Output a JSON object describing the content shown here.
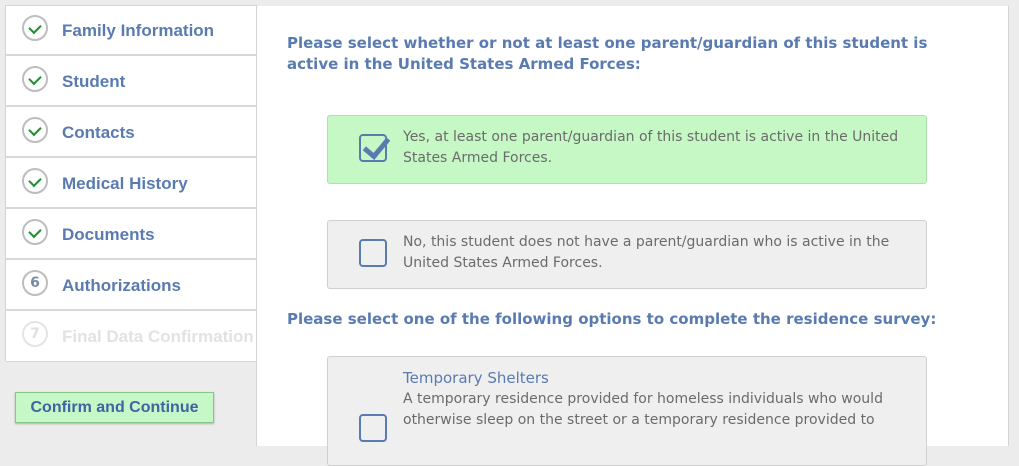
{
  "sidebar": {
    "steps": [
      {
        "marker": "",
        "label": "Family Information",
        "state": "complete"
      },
      {
        "marker": "",
        "label": "Student",
        "state": "complete"
      },
      {
        "marker": "",
        "label": "Contacts",
        "state": "complete"
      },
      {
        "marker": "",
        "label": "Medical History",
        "state": "complete"
      },
      {
        "marker": "",
        "label": "Documents",
        "state": "complete"
      },
      {
        "marker": "6",
        "label": "Authorizations",
        "state": "current"
      },
      {
        "marker": "7",
        "label": "Final Data Confirmation",
        "state": "disabled"
      }
    ],
    "confirm_label": "Confirm and Continue"
  },
  "main": {
    "military_question": "Please select whether or not at least one parent/guardian of this student is active in the United States Armed Forces:",
    "military_options": [
      {
        "text": "Yes, at least one parent/guardian of this student is active in the United States Armed Forces.",
        "checked": true
      },
      {
        "text": "No, this student does not have a parent/guardian who is active in the United States Armed Forces.",
        "checked": false
      }
    ],
    "residence_question": "Please select one of the following options to complete the residence survey:",
    "residence_options": [
      {
        "title": "Temporary Shelters",
        "text": "A temporary residence provided for homeless individuals who would otherwise sleep on the street or a temporary residence provided to",
        "checked": false
      }
    ]
  },
  "colors": {
    "accent": "#5a7bb0",
    "selected_bg": "#c6f8c6",
    "option_bg": "#efefef",
    "complete_check": "#1f8f2f"
  }
}
